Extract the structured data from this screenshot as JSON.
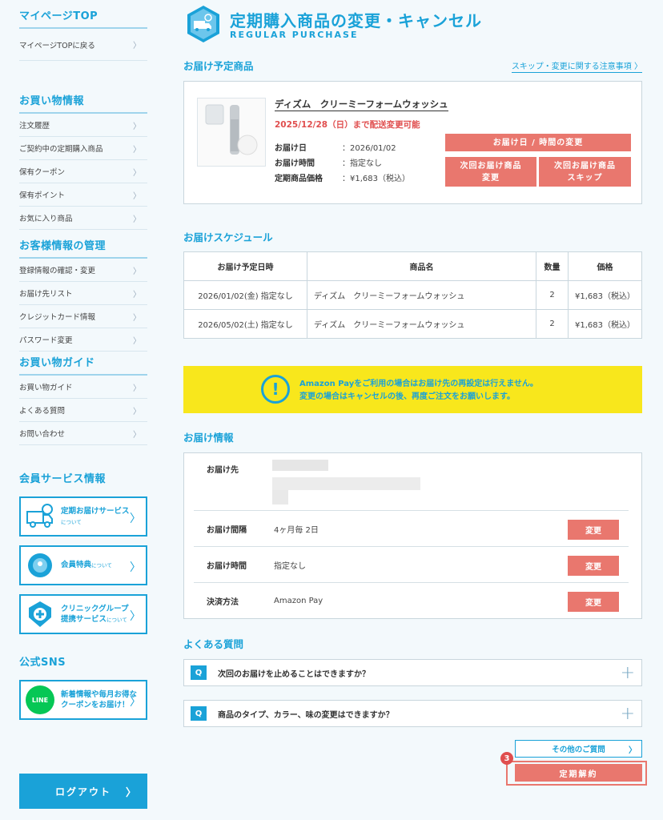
{
  "sidebar": {
    "mypage_heading": "マイページTOP",
    "mypage_back": "マイページTOPに戻る",
    "shopping_heading": "お買い物情報",
    "shopping_items": [
      "注文履歴",
      "ご契約中の定期購入商品",
      "保有クーポン",
      "保有ポイント",
      "お気に入り商品"
    ],
    "customer_heading": "お客様情報の管理",
    "customer_items": [
      "登録情報の確認・変更",
      "お届け先リスト",
      "クレジットカード情報",
      "パスワード変更"
    ],
    "guide_heading": "お買い物ガイド",
    "guide_items": [
      "お買い物ガイド",
      "よくある質問",
      "お問い合わせ"
    ],
    "member_heading": "会員サービス情報",
    "svc_delivery": "定期お届けサービス",
    "svc_delivery_small": "について",
    "svc_benefit": "会員特典",
    "svc_benefit_small": "について",
    "svc_clinic_1": "クリニックグループ",
    "svc_clinic_2": "提携サービス",
    "svc_clinic_small": "について",
    "sns_heading": "公式SNS",
    "line_logo": "LINE",
    "line_1": "新着情報や毎月お得な",
    "line_2": "クーポンをお届け！",
    "logout": "ログアウト",
    "chev": "〉"
  },
  "header": {
    "title": "定期購入商品の変更・キャンセル",
    "subtitle": "REGULAR PURCHASE"
  },
  "product": {
    "section_title": "お届け予定商品",
    "notice_link": "スキップ・変更に関する注意事項 〉",
    "name": "ディズム　クリーミーフォームウォッシュ",
    "deadline": "2025/12/28（日）まで配送変更可能",
    "date_label": "お届け日",
    "date_value": "：2026/01/02",
    "time_label": "お届け時間",
    "time_value": "：指定なし",
    "price_label": "定期商品価格",
    "price_value": "：¥1,683（税込）",
    "btn_change_date": "お届け日 / 時間の変更",
    "btn_next_change_1": "次回お届け商品",
    "btn_next_change_2": "変更",
    "btn_skip_1": "次回お届け商品",
    "btn_skip_2": "スキップ"
  },
  "schedule": {
    "section_title": "お届けスケジュール",
    "headers": [
      "お届け予定日時",
      "商品名",
      "数量",
      "価格"
    ],
    "rows": [
      [
        "2026/01/02(金) 指定なし",
        "ディズム　クリーミーフォームウォッシュ",
        "2",
        "¥1,683（税込）"
      ],
      [
        "2026/05/02(土) 指定なし",
        "ディズム　クリーミーフォームウォッシュ",
        "2",
        "¥1,683（税込）"
      ]
    ]
  },
  "amazon_notice": {
    "mark": "!",
    "line1": "Amazon Payをご利用の場合はお届け先の再設定は行えません。",
    "line2": "変更の場合はキャンセルの後、再度ご注文をお願いします。"
  },
  "delivery_info": {
    "section_title": "お届け情報",
    "address_label": "お届け先",
    "interval_label": "お届け間隔",
    "interval_value": "4ヶ月毎 2日",
    "time_label": "お届け時間",
    "time_value": "指定なし",
    "payment_label": "決済方法",
    "payment_value": "Amazon Pay",
    "change": "変更"
  },
  "faq": {
    "section_title": "よくある質問",
    "q_mark": "Q",
    "q1": "次回のお届けを止めることはできますか？",
    "q2": "商品のタイプ、カラー、味の変更はできますか？",
    "plus": "+",
    "other": "その他のご質問",
    "other_chev": "〉"
  },
  "cancel": {
    "step": "3",
    "label": "定期解約"
  },
  "colors": {
    "accent": "#1aa2d8",
    "button_red": "#e9776e",
    "notice_yellow": "#f8e71c"
  }
}
